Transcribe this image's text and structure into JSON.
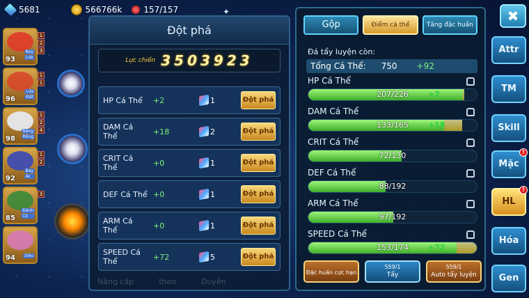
{
  "topbar": {
    "gems": "5681",
    "gold": "566766k",
    "capacity": "157/157"
  },
  "roster": [
    {
      "level": "93",
      "types": [
        "Bay",
        "Lửa"
      ],
      "slots": [
        "1",
        "2",
        "3"
      ],
      "color": "#e03a2a"
    },
    {
      "level": "96",
      "types": [
        "Lửa",
        "Đất"
      ],
      "slots": [
        "1",
        "1"
      ],
      "color": "#d8482a"
    },
    {
      "level": "98",
      "types": [
        "Băng",
        "Rồng"
      ],
      "slots": [
        "1",
        "2",
        "4"
      ],
      "color": "#e8eef6"
    },
    {
      "level": "92",
      "types": [
        "Bay",
        "Ác"
      ],
      "slots": [
        "1",
        "2"
      ],
      "color": "#3a4ab8"
    },
    {
      "level": "85",
      "types": [
        "Đánh",
        "Cỏ"
      ],
      "slots": [
        "3"
      ],
      "color": "#3a8a3a"
    },
    {
      "level": "94",
      "types": [
        "Siêu"
      ],
      "slots": [],
      "color": "#d87ab8"
    }
  ],
  "break_panel": {
    "title": "Đột phá",
    "power_label": "Lực chiến",
    "power_value": "3503923",
    "rows": [
      {
        "name": "HP Cá Thể",
        "bonus": "+2",
        "count": "1",
        "button": "Đột phá"
      },
      {
        "name": "DAM Cá Thể",
        "bonus": "+18",
        "count": "2",
        "button": "Đột phá"
      },
      {
        "name": "CRIT Cá Thể",
        "bonus": "+0",
        "count": "1",
        "button": "Đột phá"
      },
      {
        "name": "DEF Cá Thể",
        "bonus": "+0",
        "count": "1",
        "button": "Đột phá"
      },
      {
        "name": "ARM Cá Thể",
        "bonus": "+0",
        "count": "1",
        "button": "Đột phá"
      },
      {
        "name": "SPEED Cá Thể",
        "bonus": "+72",
        "count": "5",
        "button": "Đột phá"
      }
    ],
    "faded_labels": [
      "Nâng cấp",
      "theo",
      "Duyên"
    ]
  },
  "train_panel": {
    "tabs": [
      "Gộp",
      "Điểm cá thể",
      "Tăng đặc huấn"
    ],
    "remain_label": "Đá tẩy luyện còn:",
    "total_label": "Tổng Cá Thể:",
    "total_value": "750",
    "total_plus": "+92",
    "stats": [
      {
        "name": "HP Cá Thể",
        "text": "207/226",
        "plus": "+2",
        "fill": 0.916,
        "gain": 0.009
      },
      {
        "name": "DAM Cá Thể",
        "text": "133/165",
        "plus": "+18",
        "fill": 0.806,
        "gain": 0.109
      },
      {
        "name": "CRIT Cá Thể",
        "text": "72/130",
        "plus": "",
        "fill": 0.554,
        "gain": 0
      },
      {
        "name": "DEF Cá Thể",
        "text": "88/192",
        "plus": "",
        "fill": 0.458,
        "gain": 0
      },
      {
        "name": "ARM Cá Thể",
        "text": "97/192",
        "plus": "",
        "fill": 0.505,
        "gain": 0
      },
      {
        "name": "SPEED Cá Thể",
        "text": "153/174",
        "plus": "+72",
        "fill": 0.879,
        "gain": 0.121
      }
    ],
    "btn_special": "Đặc huấn cực hạn",
    "btn_wash_count": "559/1",
    "btn_wash": "Tẩy",
    "btn_auto_count": "559/1",
    "btn_auto": "Auto tẩy luyện"
  },
  "side_buttons": [
    {
      "label": "Attr",
      "badge": ""
    },
    {
      "label": "TM",
      "badge": ""
    },
    {
      "label": "Skill",
      "badge": ""
    },
    {
      "label": "Mặc",
      "badge": "!"
    },
    {
      "label": "HL",
      "badge": "!"
    },
    {
      "label": "Hóa",
      "badge": ""
    },
    {
      "label": "Gen",
      "badge": ""
    }
  ],
  "close_symbol": "✖",
  "sparkle": "✦"
}
